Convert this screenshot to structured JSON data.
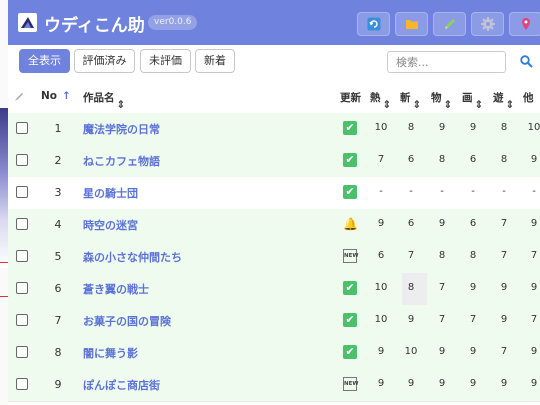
{
  "header": {
    "app_title": "ウディこん助",
    "version": "ver0.0.6",
    "buttons": [
      {
        "icon": "refresh-icon"
      },
      {
        "icon": "folder-icon"
      },
      {
        "icon": "pencil-icon"
      },
      {
        "icon": "gear-icon"
      },
      {
        "icon": "map-pin-icon"
      }
    ]
  },
  "filters": {
    "all": "全表示",
    "rated": "評価済み",
    "unrated": "未評価",
    "new": "新着"
  },
  "search": {
    "placeholder": "検索..."
  },
  "columns": {
    "no": "No",
    "sort_asc": "↑",
    "title": "作品名",
    "update": "更新",
    "c1": "熱",
    "c2": "斬",
    "c3": "物",
    "c4": "画",
    "c5": "遊",
    "c6": "他"
  },
  "colors": {
    "accent": "#6f82dd",
    "row_green": "#f0fbf0",
    "link": "#5b73d6",
    "check": "#4cbf6a"
  },
  "rows": [
    {
      "no": "1",
      "title": "魔法学院の日常",
      "status": "check",
      "v": [
        "10",
        "8",
        "9",
        "9",
        "8",
        "10"
      ]
    },
    {
      "no": "2",
      "title": "ねこカフェ物語",
      "status": "check",
      "v": [
        "7",
        "6",
        "8",
        "6",
        "8",
        "9"
      ]
    },
    {
      "no": "3",
      "title": "星の騎士団",
      "status": "check",
      "v": [
        "-",
        "-",
        "-",
        "-",
        "-",
        "-"
      ]
    },
    {
      "no": "4",
      "title": "時空の迷宮",
      "status": "bell",
      "v": [
        "9",
        "6",
        "9",
        "6",
        "7",
        "9"
      ]
    },
    {
      "no": "5",
      "title": "森の小さな仲間たち",
      "status": "new",
      "v": [
        "6",
        "7",
        "8",
        "8",
        "7",
        "7"
      ]
    },
    {
      "no": "6",
      "title": "蒼き翼の戦士",
      "status": "check",
      "v": [
        "10",
        "8",
        "7",
        "9",
        "9",
        "9"
      ]
    },
    {
      "no": "7",
      "title": "お菓子の国の冒険",
      "status": "check",
      "v": [
        "10",
        "9",
        "7",
        "7",
        "9",
        "7"
      ]
    },
    {
      "no": "8",
      "title": "闇に舞う影",
      "status": "check",
      "v": [
        "9",
        "10",
        "9",
        "9",
        "7",
        "9"
      ]
    },
    {
      "no": "9",
      "title": "ぽんぽこ商店街",
      "status": "new",
      "v": [
        "9",
        "9",
        "9",
        "9",
        "9",
        "9"
      ]
    }
  ],
  "status_glyphs": {
    "check": "✔",
    "bell": "🔔",
    "new": "NEW"
  }
}
